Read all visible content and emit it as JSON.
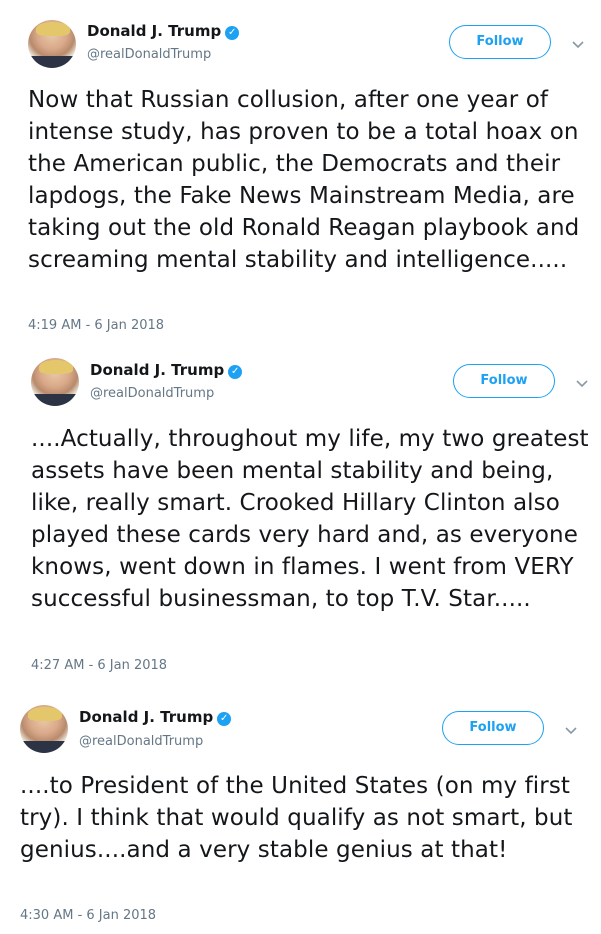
{
  "tweets": [
    {
      "name": "Donald J. Trump",
      "handle": "@realDonaldTrump",
      "follow_label": "Follow",
      "text": "Now that Russian collusion, after one year of intense study, has proven to be a total hoax on the American public, the Democrats and their lapdogs, the Fake News Mainstream Media, are taking out the old Ronald Reagan playbook and screaming mental stability and intelligence.....",
      "timestamp": "4:19 AM - 6 Jan 2018"
    },
    {
      "name": "Donald J. Trump",
      "handle": "@realDonaldTrump",
      "follow_label": "Follow",
      "text": "....Actually, throughout my life, my two greatest assets have been mental stability and being, like, really smart. Crooked Hillary Clinton also played these cards very hard and, as everyone knows, went down in flames. I went from VERY successful businessman, to top T.V. Star.....",
      "timestamp": "4:27 AM - 6 Jan 2018"
    },
    {
      "name": "Donald J. Trump",
      "handle": "@realDonaldTrump",
      "follow_label": "Follow",
      "text": "....to President of the United States (on my first try). I think that would qualify as not smart, but genius....and a very stable genius at that!",
      "timestamp": "4:30 AM - 6 Jan 2018"
    }
  ],
  "colors": {
    "accent": "#1da1f2",
    "text": "#14171a",
    "muted": "#657786"
  },
  "icons": {
    "verified": "verified-badge-icon",
    "chevron": "chevron-down-icon"
  }
}
